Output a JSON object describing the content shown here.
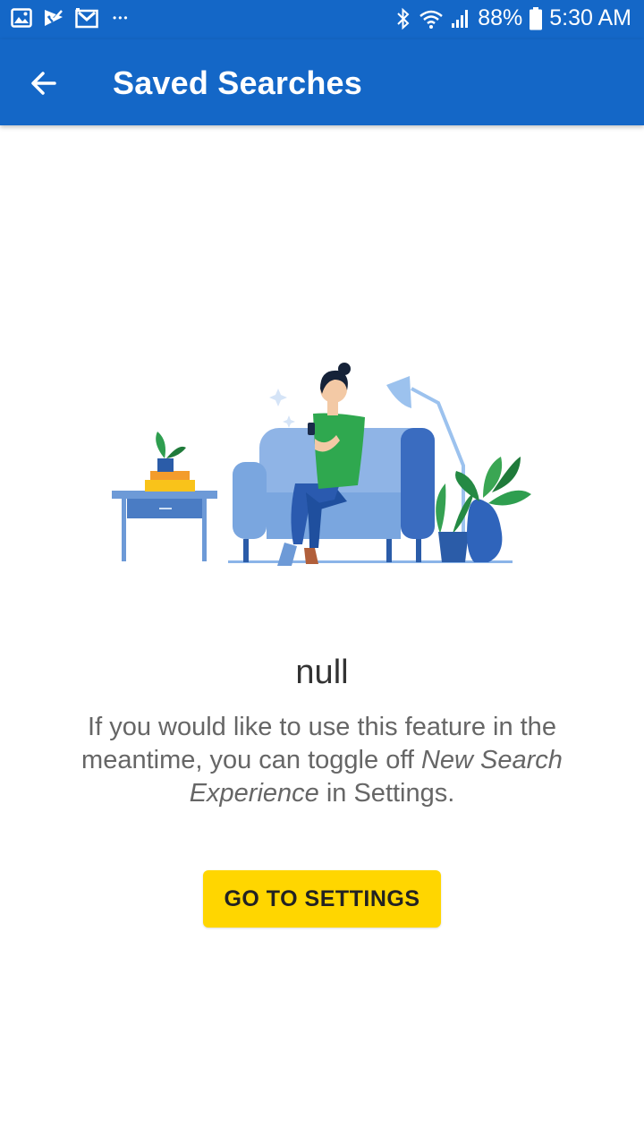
{
  "status_bar": {
    "battery": "88%",
    "time": "5:30 AM",
    "overflow_dots": "•••",
    "icons": [
      "gallery-icon",
      "email-check-icon",
      "gmail-icon",
      "bluetooth-icon",
      "wifi-icon",
      "signal-icon",
      "battery-icon"
    ]
  },
  "app_bar": {
    "title": "Saved Searches",
    "back_icon": "arrow-back-icon",
    "color": "#1467c7"
  },
  "empty_state": {
    "title": "null",
    "message_part1": "If you would like to use this feature in the meantime, you can toggle off ",
    "message_emphasis": "New Search Experience",
    "message_part2": " in Settings.",
    "button_label": "GO TO SETTINGS",
    "button_color": "#ffd600"
  }
}
